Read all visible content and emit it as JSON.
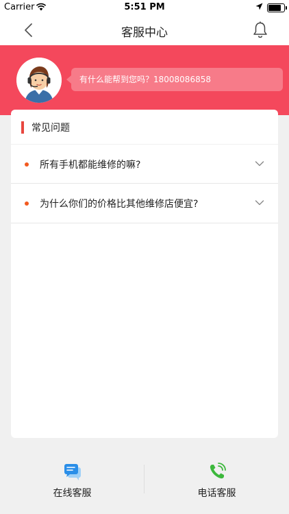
{
  "status_bar": {
    "carrier": "Carrier",
    "time": "5:51 PM",
    "battery_level": 0.9
  },
  "nav": {
    "title": "客服中心",
    "back_icon": "chevron-left-icon",
    "notification_icon": "bell-icon"
  },
  "banner": {
    "color": "#f4485c",
    "greeting": "有什么能帮到您吗？18008086858"
  },
  "faq": {
    "title": "常见问题",
    "accent_color": "#e8473f",
    "items": [
      {
        "question": "所有手机都能维修的嘛?"
      },
      {
        "question": "为什么你们的价格比其他维修店便宜?"
      }
    ]
  },
  "bottom": {
    "online_label": "在线客服",
    "online_icon": "chat-bubbles-icon",
    "phone_label": "电话客服",
    "phone_icon": "phone-call-icon",
    "phone_icon_color": "#3cb83c",
    "online_icon_color": "#2a8ee8"
  }
}
